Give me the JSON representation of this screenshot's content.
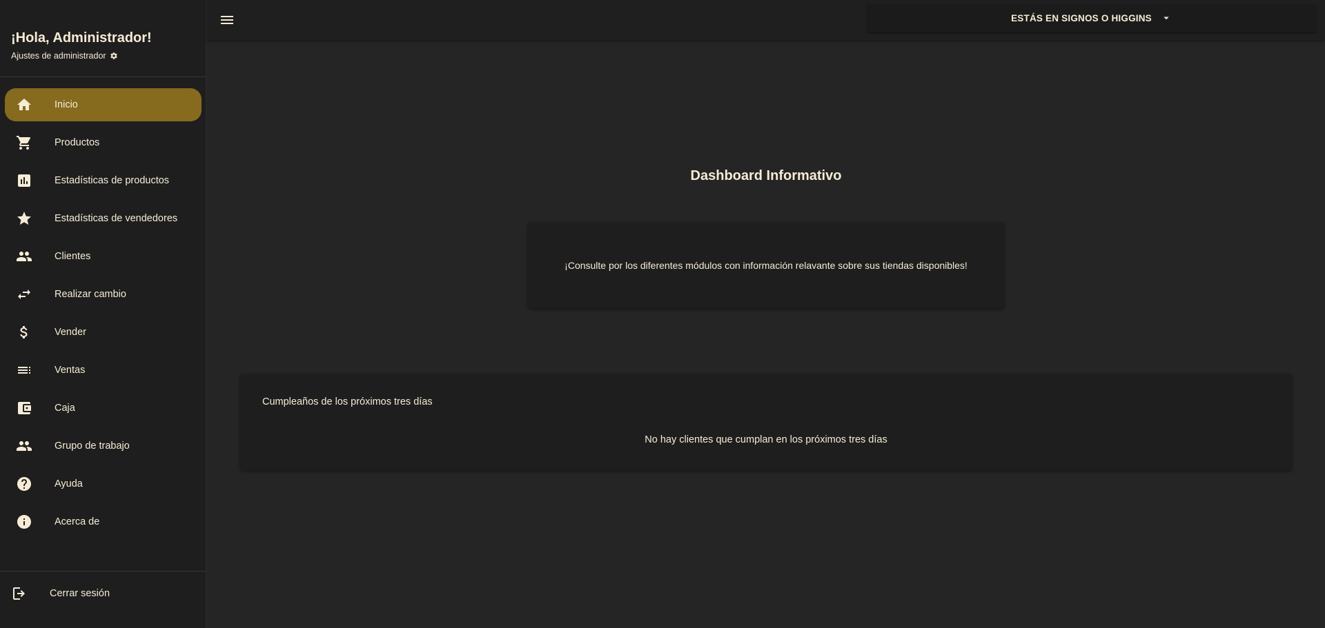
{
  "sidebar": {
    "greeting": "¡Hola, Administrador!",
    "admin_settings": "Ajustes de administrador",
    "admin_settings_icon": "gear-icon",
    "items": [
      {
        "label": "Inicio",
        "icon": "home-icon",
        "active": true
      },
      {
        "label": "Productos",
        "icon": "cart-icon",
        "active": false
      },
      {
        "label": "Estadísticas de productos",
        "icon": "bar-chart-icon",
        "active": false
      },
      {
        "label": "Estadísticas de vendedores",
        "icon": "star-icon",
        "active": false
      },
      {
        "label": "Clientes",
        "icon": "people-icon",
        "active": false
      },
      {
        "label": "Realizar cambio",
        "icon": "swap-icon",
        "active": false
      },
      {
        "label": "Vender",
        "icon": "dollar-icon",
        "active": false
      },
      {
        "label": "Ventas",
        "icon": "list-icon",
        "active": false
      },
      {
        "label": "Caja",
        "icon": "wallet-icon",
        "active": false
      },
      {
        "label": "Grupo de trabajo",
        "icon": "people-icon",
        "active": false
      },
      {
        "label": "Ayuda",
        "icon": "help-icon",
        "active": false
      },
      {
        "label": "Acerca de",
        "icon": "info-icon",
        "active": false
      }
    ],
    "logout": "Cerrar sesión",
    "logout_icon": "logout-icon"
  },
  "topbar": {
    "menu_icon": "hamburger-icon",
    "store_label": "ESTÁS EN SIGNOS O HIGGINS",
    "dropdown_icon": "caret-down-icon"
  },
  "main": {
    "title": "Dashboard Informativo",
    "info_text": "¡Consulte por los diferentes módulos con información relavante sobre sus tiendas disponibles!",
    "birthdays": {
      "title": "Cumpleaños de los próximos tres días",
      "empty_text": "No hay clientes que cumplan en los próximos tres días"
    }
  },
  "colors": {
    "background": "#252525",
    "sidebar": "#1e1e1e",
    "accent_active": "#866b1f",
    "text": "#f6ecd6"
  }
}
